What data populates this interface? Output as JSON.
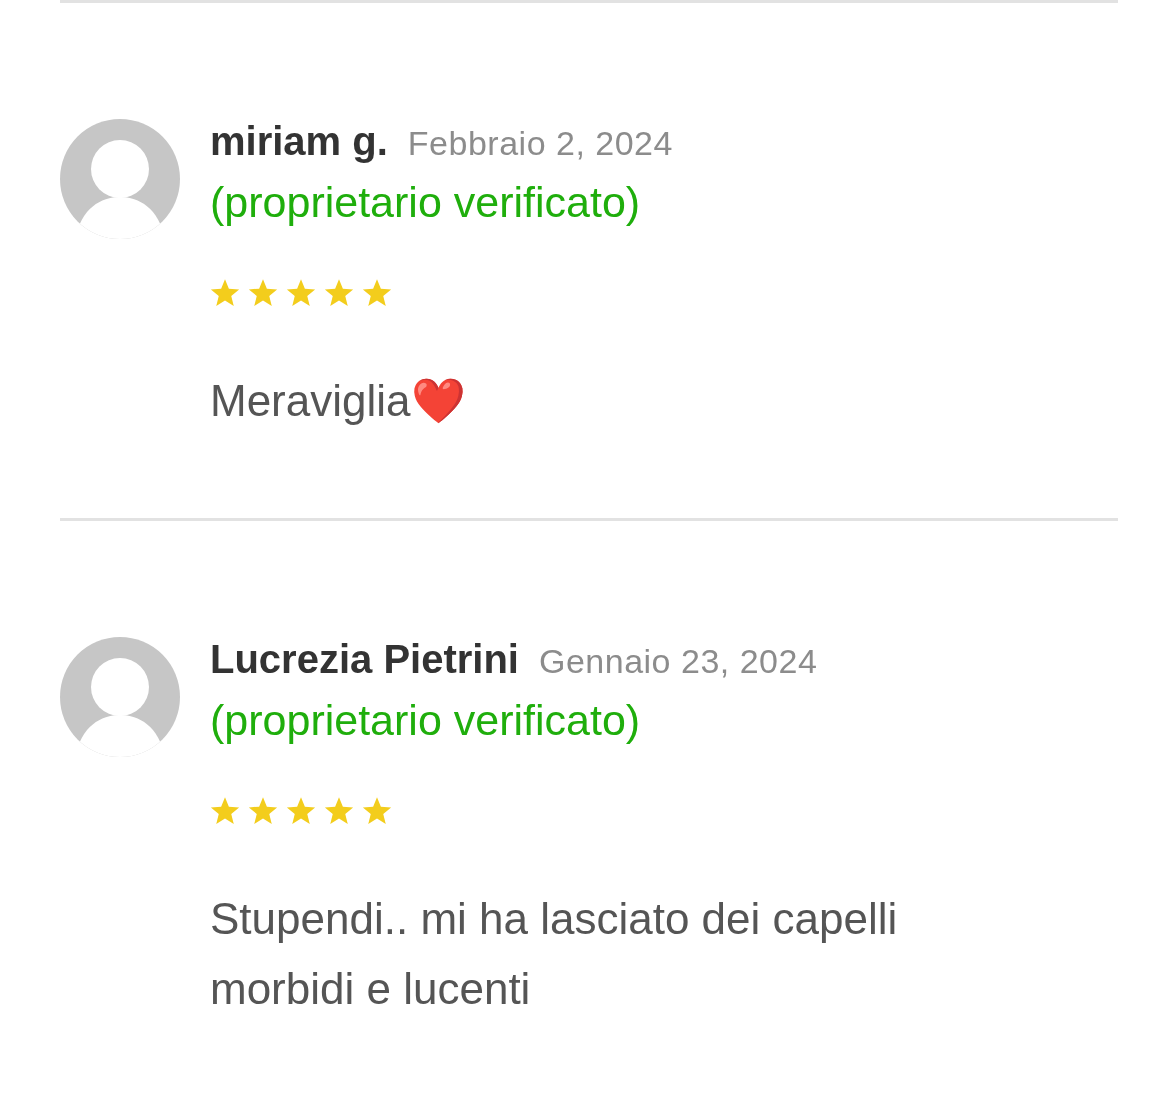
{
  "reviews": [
    {
      "author": "miriam g.",
      "date": "Febbraio 2, 2024",
      "badge": "(proprietario verificato)",
      "stars": 5,
      "text": "Meraviglia❤️"
    },
    {
      "author": "Lucrezia Pietrini",
      "date": "Gennaio 23, 2024",
      "badge": "(proprietario verificato)",
      "stars": 5,
      "text": "Stupendi.. mi ha lasciato dei capelli morbidi e lucenti"
    }
  ]
}
